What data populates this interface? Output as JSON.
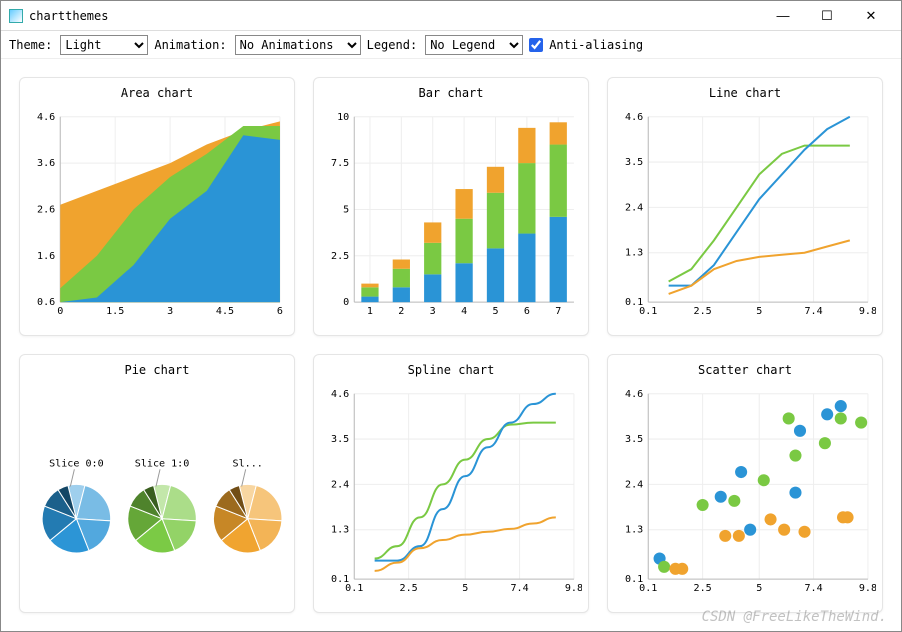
{
  "window": {
    "title": "chartthemes"
  },
  "toolbar": {
    "theme_label": "Theme:",
    "theme_value": "Light",
    "animation_label": "Animation:",
    "animation_value": "No Animations",
    "legend_label": "Legend:",
    "legend_value": "No Legend",
    "antialias_label": "Anti-aliasing",
    "antialias_checked": true
  },
  "colors": {
    "blue": "#2a94d6",
    "green": "#7ac943",
    "orange": "#f0a32e"
  },
  "watermark": "CSDN @FreeLikeTheWind.",
  "chart_data": [
    {
      "id": "area",
      "type": "area",
      "title": "Area chart",
      "xlabel": "",
      "ylabel": "",
      "xlim": [
        0,
        6
      ],
      "ylim": [
        0.6,
        4.6
      ],
      "xticks": [
        0.0,
        1.5,
        3.0,
        4.5,
        6.0
      ],
      "yticks": [
        0.6,
        1.6,
        2.6,
        3.6,
        4.6
      ],
      "x": [
        0,
        1,
        2,
        3,
        4,
        5,
        6
      ],
      "series": [
        {
          "name": "blue",
          "color": "blue",
          "values": [
            0.6,
            0.7,
            1.4,
            2.4,
            3.0,
            4.2,
            4.1
          ]
        },
        {
          "name": "green",
          "color": "green",
          "values": [
            0.9,
            1.6,
            2.6,
            3.3,
            3.8,
            4.4,
            4.4
          ]
        },
        {
          "name": "orange",
          "color": "orange",
          "values": [
            2.7,
            3.0,
            3.3,
            3.6,
            4.0,
            4.3,
            4.5
          ]
        }
      ]
    },
    {
      "id": "bar",
      "type": "bar",
      "title": "Bar chart",
      "xlabel": "",
      "ylabel": "",
      "xlim": [
        0.5,
        7.5
      ],
      "ylim": [
        0,
        10
      ],
      "xticks": [
        1,
        2,
        3,
        4,
        5,
        6,
        7
      ],
      "yticks": [
        0,
        2.5,
        5.0,
        7.5,
        10.0
      ],
      "categories": [
        1,
        2,
        3,
        4,
        5,
        6,
        7
      ],
      "stack": true,
      "series": [
        {
          "name": "blue",
          "color": "blue",
          "values": [
            0.3,
            0.8,
            1.5,
            2.1,
            2.9,
            3.7,
            4.6
          ]
        },
        {
          "name": "green",
          "color": "green",
          "values": [
            0.5,
            1.0,
            1.7,
            2.4,
            3.0,
            3.8,
            3.9
          ]
        },
        {
          "name": "orange",
          "color": "orange",
          "values": [
            0.2,
            0.5,
            1.1,
            1.6,
            1.4,
            1.9,
            1.2
          ]
        }
      ]
    },
    {
      "id": "line",
      "type": "line",
      "title": "Line chart",
      "xlabel": "",
      "ylabel": "",
      "xlim": [
        0.1,
        9.8
      ],
      "ylim": [
        0.1,
        4.6
      ],
      "xticks": [
        0.1,
        2.5,
        5.0,
        7.4,
        9.8
      ],
      "yticks": [
        0.1,
        1.3,
        2.4,
        3.5,
        4.6
      ],
      "x": [
        1,
        2,
        3,
        4,
        5,
        6,
        7,
        8,
        9
      ],
      "series": [
        {
          "name": "green",
          "color": "green",
          "values": [
            0.6,
            0.9,
            1.6,
            2.4,
            3.2,
            3.7,
            3.9,
            3.9,
            3.9
          ]
        },
        {
          "name": "blue",
          "color": "blue",
          "values": [
            0.5,
            0.5,
            1.0,
            1.8,
            2.6,
            3.2,
            3.8,
            4.3,
            4.6
          ]
        },
        {
          "name": "orange",
          "color": "orange",
          "values": [
            0.3,
            0.5,
            0.9,
            1.1,
            1.2,
            1.25,
            1.3,
            1.45,
            1.6
          ]
        }
      ]
    },
    {
      "id": "pie",
      "type": "pie",
      "title": "Pie chart",
      "labels": [
        "Slice 0:0",
        "Slice 1:0",
        "Sl..."
      ],
      "pies": [
        {
          "palette_base": "blue",
          "slices": [
            8,
            22,
            18,
            20,
            17,
            10,
            5
          ]
        },
        {
          "palette_base": "green",
          "slices": [
            8,
            22,
            18,
            20,
            17,
            10,
            5
          ]
        },
        {
          "palette_base": "orange",
          "slices": [
            8,
            22,
            18,
            20,
            17,
            10,
            5
          ]
        }
      ]
    },
    {
      "id": "spline",
      "type": "line",
      "title": "Spline chart",
      "xlabel": "",
      "ylabel": "",
      "xlim": [
        0.1,
        9.8
      ],
      "ylim": [
        0.1,
        4.6
      ],
      "xticks": [
        0.1,
        2.5,
        5.0,
        7.4,
        9.8
      ],
      "yticks": [
        0.1,
        1.3,
        2.4,
        3.5,
        4.6
      ],
      "smooth": true,
      "x": [
        1,
        2,
        3,
        4,
        5,
        6,
        7,
        8,
        9
      ],
      "series": [
        {
          "name": "green",
          "color": "green",
          "values": [
            0.6,
            0.9,
            1.6,
            2.4,
            3.0,
            3.5,
            3.85,
            3.9,
            3.9
          ]
        },
        {
          "name": "blue",
          "color": "blue",
          "values": [
            0.55,
            0.55,
            0.9,
            1.8,
            2.6,
            3.3,
            3.9,
            4.35,
            4.6
          ]
        },
        {
          "name": "orange",
          "color": "orange",
          "values": [
            0.3,
            0.5,
            0.85,
            1.05,
            1.18,
            1.25,
            1.32,
            1.45,
            1.6
          ]
        }
      ]
    },
    {
      "id": "scatter",
      "type": "scatter",
      "title": "Scatter chart",
      "xlabel": "",
      "ylabel": "",
      "xlim": [
        0.1,
        9.8
      ],
      "ylim": [
        0.1,
        4.6
      ],
      "xticks": [
        0.1,
        2.5,
        5.0,
        7.4,
        9.8
      ],
      "yticks": [
        0.1,
        1.3,
        2.4,
        3.5,
        4.6
      ],
      "series": [
        {
          "name": "blue",
          "color": "blue",
          "points": [
            [
              0.6,
              0.6
            ],
            [
              3.3,
              2.1
            ],
            [
              4.2,
              2.7
            ],
            [
              4.6,
              1.3
            ],
            [
              6.6,
              2.2
            ],
            [
              6.8,
              3.7
            ],
            [
              8.0,
              4.1
            ],
            [
              8.6,
              4.3
            ]
          ]
        },
        {
          "name": "green",
          "color": "green",
          "points": [
            [
              0.8,
              0.4
            ],
            [
              2.5,
              1.9
            ],
            [
              3.9,
              2.0
            ],
            [
              5.2,
              2.5
            ],
            [
              6.3,
              4.0
            ],
            [
              6.6,
              3.1
            ],
            [
              7.9,
              3.4
            ],
            [
              8.6,
              4.0
            ],
            [
              9.5,
              3.9
            ]
          ]
        },
        {
          "name": "orange",
          "color": "orange",
          "points": [
            [
              1.3,
              0.35
            ],
            [
              1.6,
              0.35
            ],
            [
              3.5,
              1.15
            ],
            [
              4.1,
              1.15
            ],
            [
              5.5,
              1.55
            ],
            [
              6.1,
              1.3
            ],
            [
              7.0,
              1.25
            ],
            [
              8.7,
              1.6
            ],
            [
              8.9,
              1.6
            ]
          ]
        }
      ]
    }
  ]
}
